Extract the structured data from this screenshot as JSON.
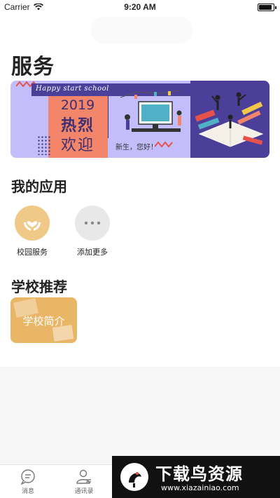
{
  "status_bar": {
    "carrier": "Carrier",
    "time": "9:20 AM"
  },
  "page": {
    "title": "服务"
  },
  "banner": {
    "tagline": "Happy start school",
    "year": "2019",
    "headline1": "热烈",
    "headline2": "欢迎",
    "greeting": "新生，您好！"
  },
  "my_apps": {
    "title": "我的应用",
    "items": [
      {
        "label": "校园服务",
        "icon": "hands-heart-icon",
        "color": "#f0c989"
      },
      {
        "label": "添加更多",
        "icon": "more-dots-icon",
        "color": "#e8e8e8"
      }
    ]
  },
  "recommend": {
    "title": "学校推荐",
    "card_label": "学校简介",
    "card_color": "#e9b566"
  },
  "tabbar": {
    "items": [
      {
        "label": "消息",
        "icon": "message-bubble-icon"
      },
      {
        "label": "通讯录",
        "icon": "contacts-icon"
      }
    ]
  },
  "watermark": {
    "title": "下载鸟资源",
    "url": "www.xiazainiao.com"
  }
}
